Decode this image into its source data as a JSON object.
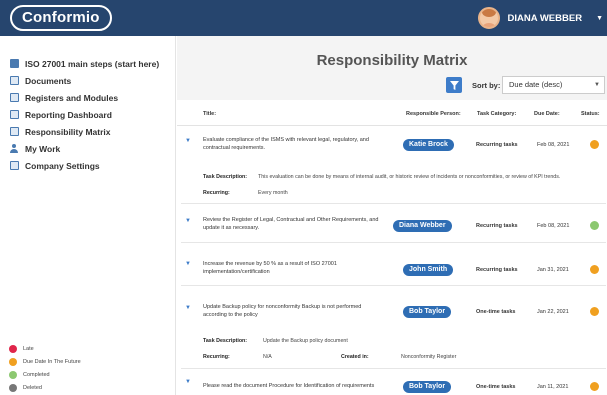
{
  "app": {
    "logo": "Conformio"
  },
  "user": {
    "name": "DIANA WEBBER"
  },
  "sidebar": {
    "items": [
      {
        "label": "ISO 27001 main steps (start here)"
      },
      {
        "label": "Documents"
      },
      {
        "label": "Registers and Modules"
      },
      {
        "label": "Reporting Dashboard"
      },
      {
        "label": "Responsibility Matrix"
      },
      {
        "label": "My Work"
      },
      {
        "label": "Company Settings"
      }
    ]
  },
  "legend": [
    {
      "label": "Late",
      "color": "#e0254a"
    },
    {
      "label": "Due Date In The Future",
      "color": "#f0a020"
    },
    {
      "label": "Completed",
      "color": "#8cc870"
    },
    {
      "label": "Deleted",
      "color": "#777777"
    }
  ],
  "main": {
    "title": "Responsibility Matrix",
    "sort_label": "Sort by:",
    "sort_value": "Due date (desc)"
  },
  "table": {
    "headers": {
      "title": "Title:",
      "person": "Responsible Person:",
      "category": "Task Category:",
      "due": "Due Date:",
      "status": "Status:"
    },
    "rows": [
      {
        "title": "Evaluate compliance of the ISMS with relevant legal, regulatory, and contractual requirements.",
        "person": "Katie Brock",
        "category": "Recurring tasks",
        "due": "Feb 08, 2021",
        "status_color": "#f0a020",
        "details": {
          "desc_label": "Task Description:",
          "desc_value": "This evaluation can be done by means of internal audit, or historic review of incidents or nonconformities, or review of KPI trends.",
          "rec_label": "Recurring:",
          "rec_value": "Every month"
        }
      },
      {
        "title": "Review the Register of Legal, Contractual and Other Requirements, and update it as necessary.",
        "person": "Diana Webber",
        "category": "Recurring tasks",
        "due": "Feb 08, 2021",
        "status_color": "#8cc870"
      },
      {
        "title": "Increase the revenue by 50 % as a result of ISO 27001 implementation/certification",
        "person": "John Smith",
        "category": "Recurring tasks",
        "due": "Jan 31, 2021",
        "status_color": "#f0a020"
      },
      {
        "title": "Update Backup policy for nonconformity Backup is not performed according to the policy",
        "person": "Bob Taylor",
        "category": "One-time tasks",
        "due": "Jan 22, 2021",
        "status_color": "#f0a020",
        "details": {
          "desc_label": "Task Description:",
          "desc_value": "Update the Backup policy document",
          "rec_label": "Recurring:",
          "rec_value": "N/A",
          "created_label": "Created in:",
          "created_value": "Nonconformity Register"
        }
      },
      {
        "title": "Please read the document Procedure for Identification of requirements",
        "person": "Bob Taylor",
        "category": "One-time tasks",
        "due": "Jan 11, 2021",
        "status_color": "#f0a020"
      }
    ]
  }
}
